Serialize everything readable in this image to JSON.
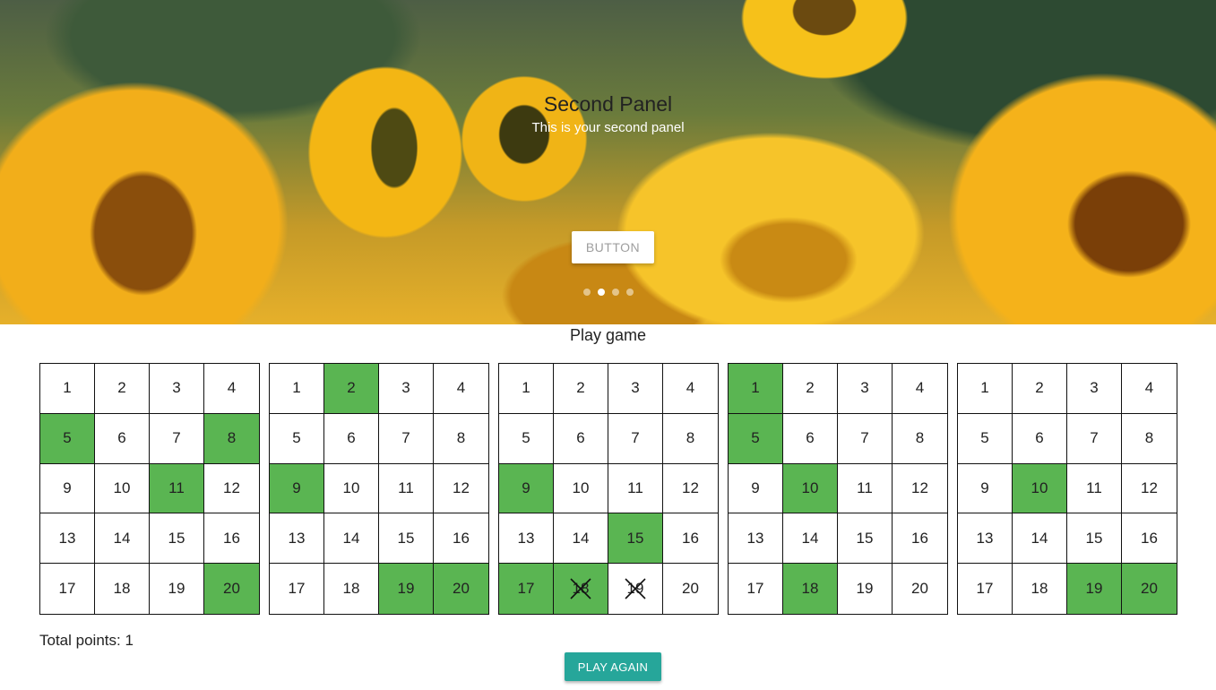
{
  "carousel": {
    "title": "Second Panel",
    "subtitle": "This is your second panel",
    "button_label": "BUTTON",
    "slide_count": 4,
    "active_slide": 2,
    "image": "sunflower-field"
  },
  "game": {
    "title": "Play game",
    "numbers": [
      1,
      2,
      3,
      4,
      5,
      6,
      7,
      8,
      9,
      10,
      11,
      12,
      13,
      14,
      15,
      16,
      17,
      18,
      19,
      20
    ],
    "boards": [
      {
        "selected": [
          5,
          8,
          11,
          20
        ],
        "crossed": []
      },
      {
        "selected": [
          2,
          9,
          19,
          20
        ],
        "crossed": []
      },
      {
        "selected": [
          9,
          15,
          17,
          18
        ],
        "crossed": [
          18,
          19
        ]
      },
      {
        "selected": [
          1,
          5,
          10,
          18
        ],
        "crossed": []
      },
      {
        "selected": [
          10,
          19,
          20
        ],
        "crossed": []
      }
    ],
    "total_points_text": "Total points: 1",
    "play_again_label": "PLAY AGAIN"
  },
  "colors": {
    "selected_cell": "#5ab552",
    "play_again_button": "#26a69a",
    "grid_border": "#111111"
  }
}
